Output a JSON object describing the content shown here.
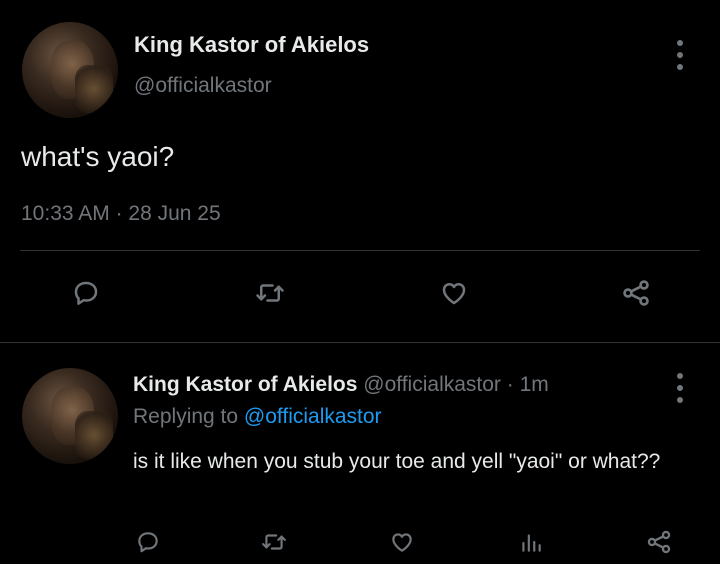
{
  "main_tweet": {
    "display_name": "King Kastor of Akielos",
    "handle": "@officialkastor",
    "text": "what's yaoi?",
    "time": "10:33 AM",
    "separator": "·",
    "date": "28 Jun 25",
    "actions": [
      "reply-icon",
      "retweet-icon",
      "like-icon",
      "share-icon"
    ]
  },
  "reply_tweet": {
    "display_name": "King Kastor of Akielos",
    "handle": "@officialkastor",
    "separator": "·",
    "time": "1m",
    "replying_prefix": "Replying to",
    "replying_to": "@officialkastor",
    "text": "is it like when you stub your toe and yell \"yaoi\" or what??",
    "actions": [
      "reply-icon",
      "retweet-icon",
      "like-icon",
      "views-icon",
      "share-icon"
    ]
  },
  "colors": {
    "background": "#000000",
    "primary_text": "#e7e9ea",
    "secondary_text": "#71767b",
    "link": "#1d9bf0",
    "divider": "#2f3336"
  }
}
